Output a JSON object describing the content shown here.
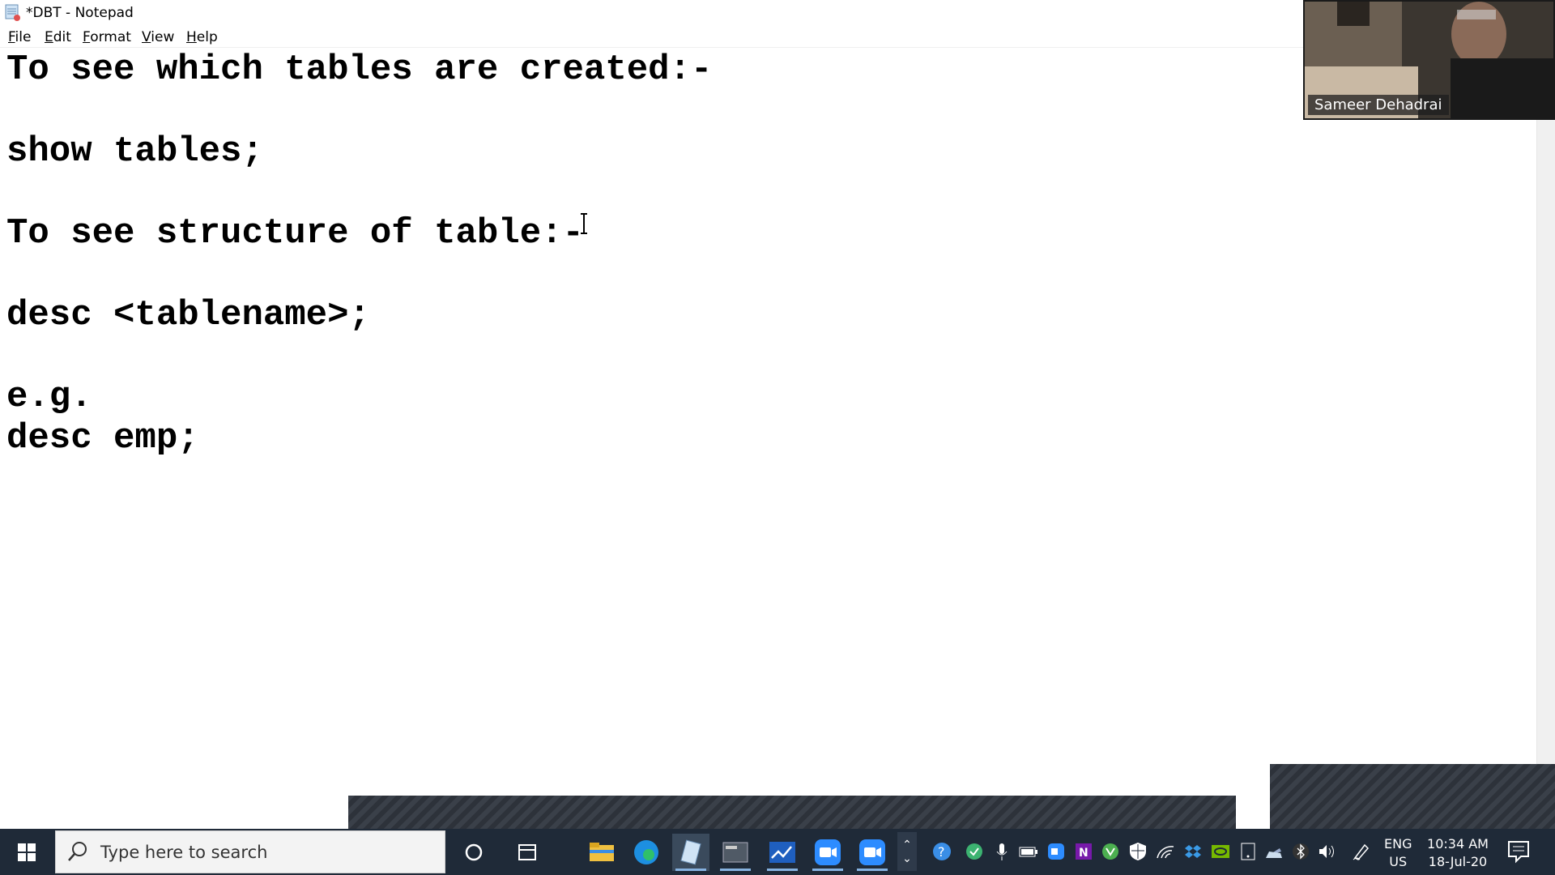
{
  "window": {
    "title": "*DBT - Notepad"
  },
  "menu": [
    "File",
    "Edit",
    "Format",
    "View",
    "Help"
  ],
  "editor": {
    "lines": [
      "To see which tables are created:-",
      "",
      "show tables;",
      "",
      "To see structure of table:-",
      "",
      "desc <tablename>;",
      "",
      "e.g.",
      "desc emp;"
    ]
  },
  "video": {
    "participant_name": "Sameer Dehadrai"
  },
  "taskbar": {
    "search_placeholder": "Type here to search",
    "language": "ENG",
    "region": "US",
    "time": "10:34 AM",
    "date": "18-Jul-20",
    "apps": [
      "cortana-icon",
      "task-view-icon",
      "file-explorer-icon",
      "edge-icon",
      "notepad-icon",
      "terminal-icon",
      "whiteboard-icon",
      "zoom-icon",
      "zoom-meeting-icon"
    ],
    "tray": [
      "chevron-up-icon",
      "help-icon",
      "shield-check-icon",
      "microphone-icon",
      "battery-icon",
      "zoom-tray-icon",
      "onenote-icon",
      "utorrent-icon",
      "defender-icon",
      "wifi-icon",
      "dropbox-icon",
      "nvidia-icon",
      "tablet-icon",
      "onedrive-icon",
      "bluetooth-icon",
      "volume-icon",
      "pen-icon"
    ]
  },
  "colors": {
    "taskbar": "#1f2a38",
    "accent": "#86b2e0",
    "hatch": "#3a4049"
  }
}
